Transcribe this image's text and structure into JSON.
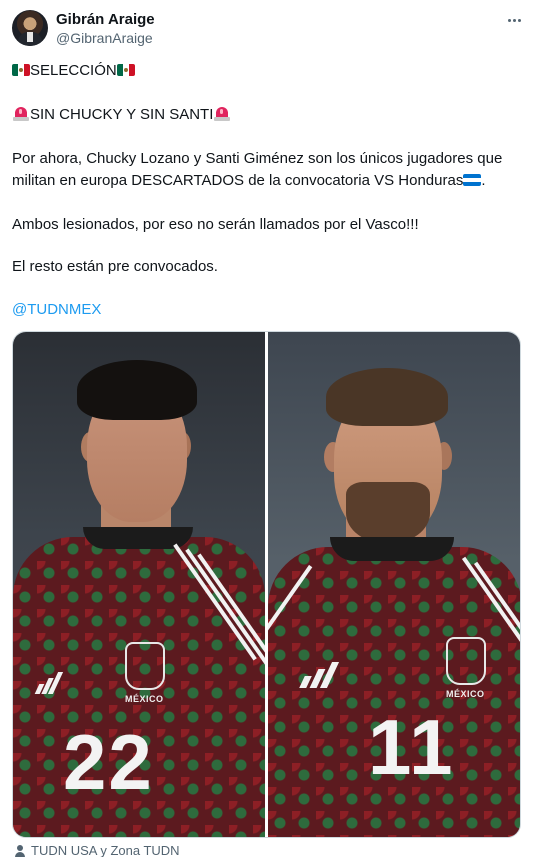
{
  "author": {
    "name": "Gibrán Araige",
    "handle": "@GibranAraige"
  },
  "tweet": {
    "line1_text": "SELECCIÓN",
    "line2_text": "SIN CHUCKY Y SIN SANTI",
    "line3a_text": "Por ahora, Chucky Lozano y Santi Giménez son los únicos jugadores que",
    "line3b_text": "militan en europa DESCARTADOS de la convocatoria VS Honduras",
    "line4_text": "Ambos lesionados, por eso no serán llamados por el Vasco!!!",
    "line5_text": "El resto están pre convocados.",
    "mention": "@TUDNMEX"
  },
  "media": {
    "left_player_number": "22",
    "right_player_number": "11",
    "crest_text": "MÉXICO"
  },
  "credit": {
    "text": "TUDN USA y Zona TUDN"
  },
  "colors": {
    "link": "#1d9bf0",
    "secondary_text": "#536471",
    "jersey_base": "#5c1a1f",
    "jersey_green": "#2e6b3d"
  }
}
